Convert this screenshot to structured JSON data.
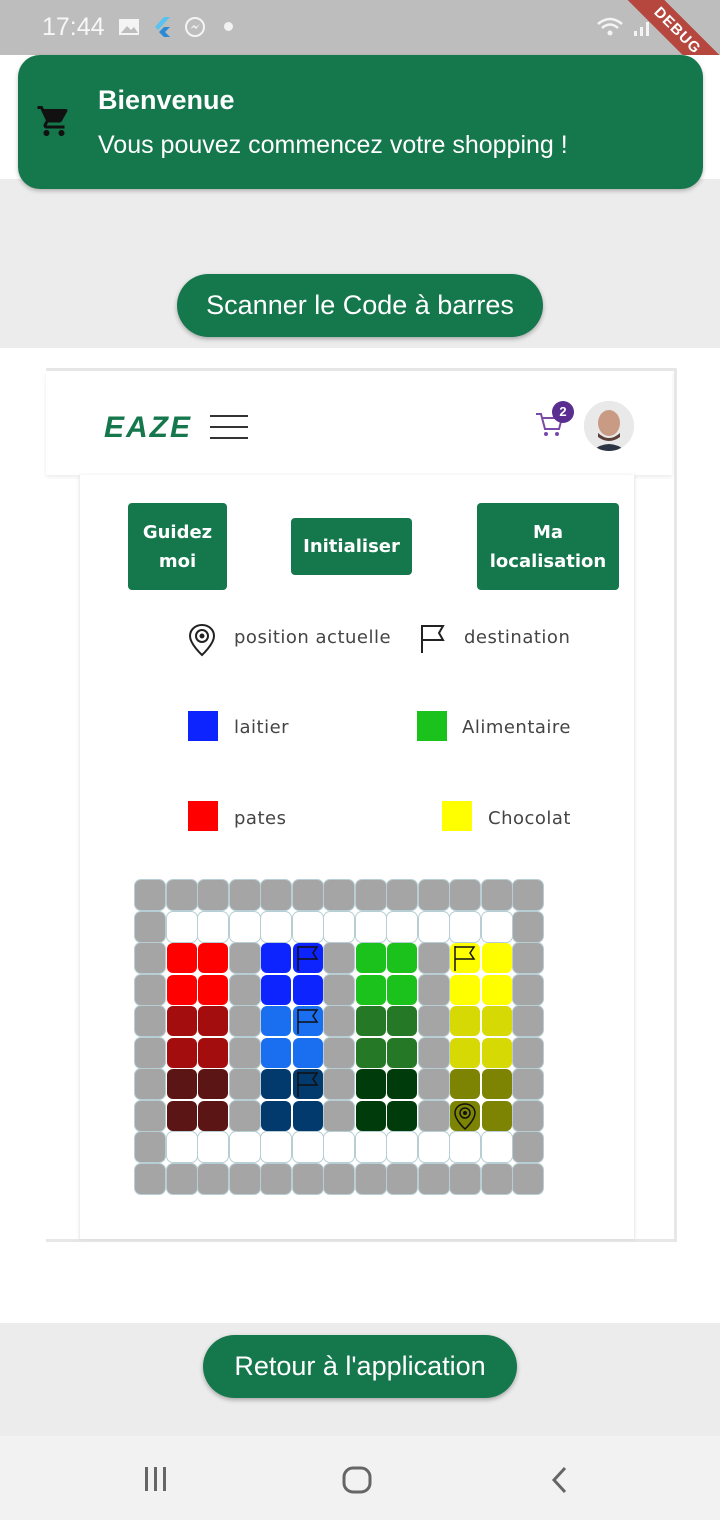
{
  "status_bar": {
    "time": "17:44",
    "debug_label": "DEBUG"
  },
  "toast": {
    "title": "Bienvenue",
    "message": "Vous pouvez commencez votre shopping !"
  },
  "scan_button": {
    "label": "Scanner le Code à barres"
  },
  "web": {
    "logo_text": "EAZE",
    "cart_count": "2",
    "buttons": {
      "guide": "Guidez moi",
      "init": "Initialiser",
      "locate": "Ma localisation"
    },
    "legend": {
      "position": "position actuelle",
      "destination": "destination",
      "laitier": "laitier",
      "alimentaire": "Alimentaire",
      "pates": "pates",
      "chocolat": "Chocolat"
    },
    "colors": {
      "laitier": "#0d24ff",
      "alimentaire": "#1bc21b",
      "pates": "#ff0000",
      "chocolat": "#ffff00"
    }
  },
  "back_button": {
    "label": "Retour à l'application"
  },
  "store_map": {
    "rows": 10,
    "cols": 13,
    "cells": [
      [
        "g",
        "g",
        "g",
        "g",
        "g",
        "g",
        "g",
        "g",
        "g",
        "g",
        "g",
        "g",
        "g"
      ],
      [
        "g",
        "w",
        "w",
        "w",
        "w",
        "w",
        "w",
        "w",
        "w",
        "w",
        "w",
        "w",
        "g"
      ],
      [
        "g",
        "r1",
        "r1",
        "g",
        "b1",
        "b1",
        "g",
        "gr1",
        "gr1",
        "g",
        "y1",
        "y1",
        "g"
      ],
      [
        "g",
        "r1",
        "r1",
        "g",
        "b1",
        "b1",
        "g",
        "gr1",
        "gr1",
        "g",
        "y1",
        "y1",
        "g"
      ],
      [
        "g",
        "r2",
        "r2",
        "g",
        "b2",
        "b2",
        "g",
        "gr2",
        "gr2",
        "g",
        "y2",
        "y2",
        "g"
      ],
      [
        "g",
        "r2",
        "r2",
        "g",
        "b2",
        "b2",
        "g",
        "gr2",
        "gr2",
        "g",
        "y2",
        "y2",
        "g"
      ],
      [
        "g",
        "r3",
        "r3",
        "g",
        "b3",
        "b3",
        "g",
        "gr3",
        "gr3",
        "g",
        "y3",
        "y3",
        "g"
      ],
      [
        "g",
        "r3",
        "r3",
        "g",
        "b3",
        "b3",
        "g",
        "gr3",
        "gr3",
        "g",
        "y3",
        "y3",
        "g"
      ],
      [
        "g",
        "w",
        "w",
        "w",
        "w",
        "w",
        "w",
        "w",
        "w",
        "w",
        "w",
        "w",
        "g"
      ],
      [
        "g",
        "g",
        "g",
        "g",
        "g",
        "g",
        "g",
        "g",
        "g",
        "g",
        "g",
        "g",
        "g"
      ]
    ],
    "palette": {
      "g": "#a5a5a5",
      "w": "#ffffff",
      "r1": "#ff0000",
      "r2": "#a40d0d",
      "r3": "#5b1515",
      "b1": "#0d24ff",
      "b2": "#1a6ef0",
      "b3": "#023a6e",
      "gr1": "#1bc21b",
      "gr2": "#247826",
      "gr3": "#003c0b",
      "y1": "#ffff00",
      "y2": "#d7d904",
      "y3": "#7d8303"
    },
    "flags": [
      [
        2,
        5
      ],
      [
        4,
        5
      ],
      [
        6,
        5
      ],
      [
        2,
        10
      ]
    ],
    "position_marker": [
      7,
      10
    ]
  }
}
